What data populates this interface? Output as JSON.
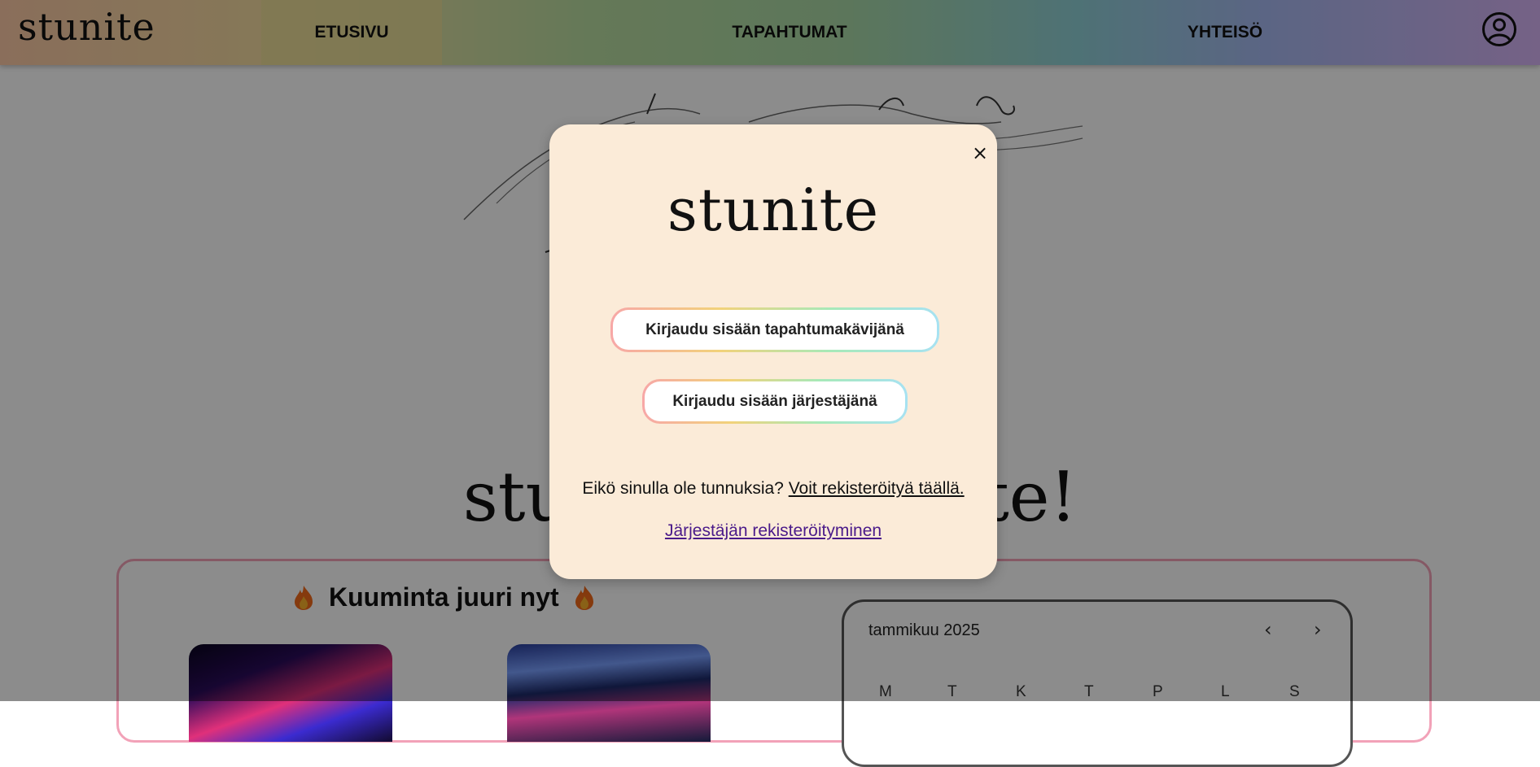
{
  "nav": {
    "logo": "stunite",
    "items": [
      {
        "label": "ETUSIVU"
      },
      {
        "label": "TAPAHTUMAT"
      },
      {
        "label": "YHTEISÖ"
      }
    ],
    "active": "ETUSIVU",
    "user_icon": "user-circle-icon"
  },
  "hero": {
    "slogan": "students  the nite!"
  },
  "trending": {
    "title": "Kuuminta juuri nyt",
    "icon": "flame-icon"
  },
  "calendar": {
    "month": "tammikuu 2025",
    "prev": "‹",
    "next": "›",
    "weekdays": [
      "M",
      "T",
      "K",
      "T",
      "P",
      "L",
      "S"
    ]
  },
  "modal": {
    "logo": "stunite",
    "close_label": "×",
    "login_attendee": "Kirjaudu sisään tapahtumakävijänä",
    "login_organizer": "Kirjaudu sisään järjestäjänä",
    "no_account_text": "Eikö sinulla ole tunnuksia?",
    "register_link": "Voit rekisteröityä täällä.",
    "organizer_register_link": "Järjestäjän rekisteröityminen"
  },
  "colors": {
    "modal_bg": "#fbebd8",
    "organizer_link": "#4a1a8a",
    "panel_border": "#f2a2b8"
  }
}
